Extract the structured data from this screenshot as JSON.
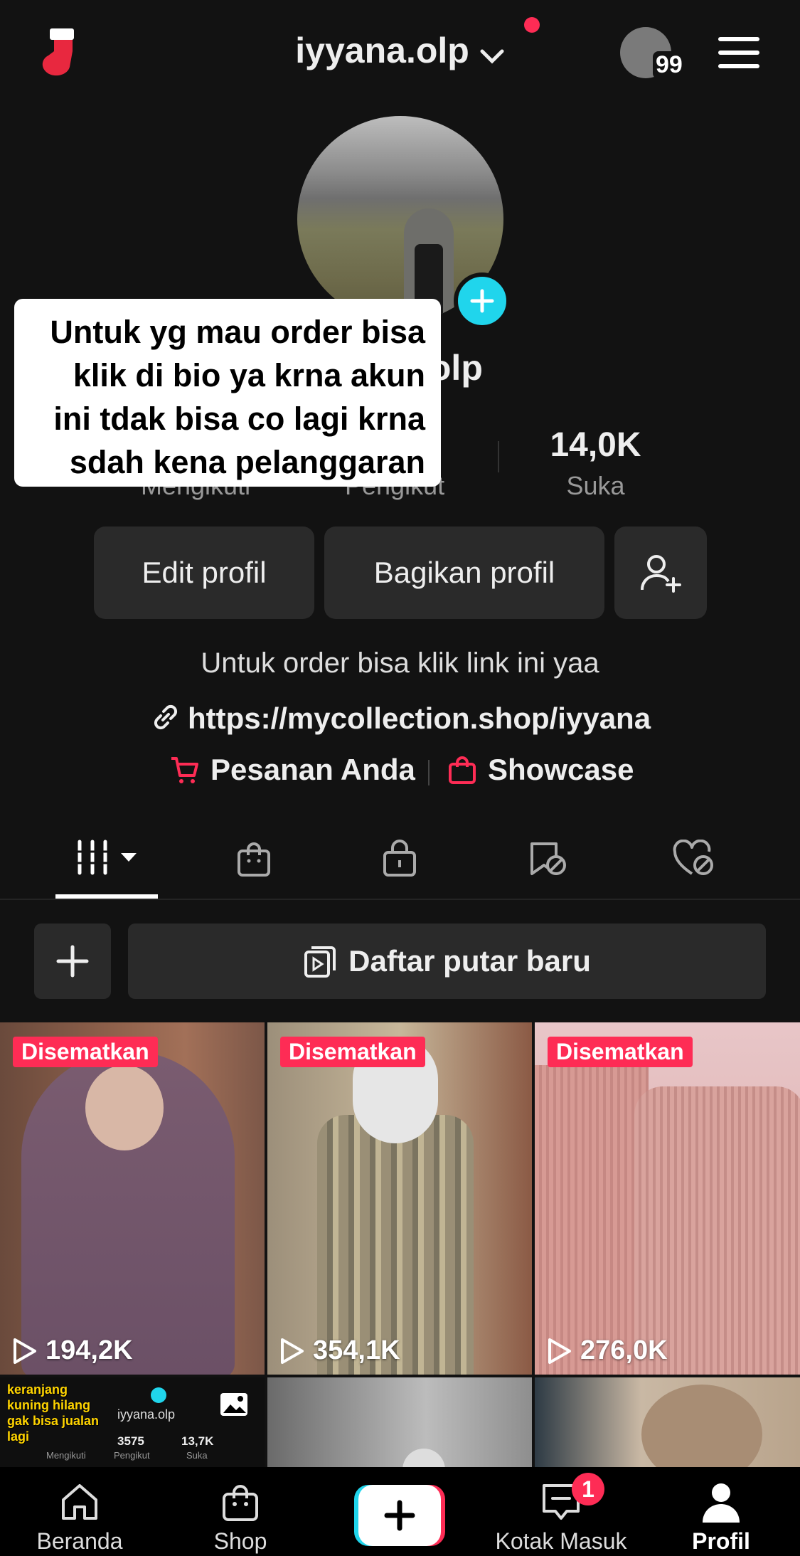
{
  "header": {
    "username": "iyyana.olp",
    "badge_count": "99"
  },
  "profile": {
    "name_partial": ".olp"
  },
  "overlay_caption": [
    "Untuk yg mau order bisa",
    "klik di bio ya krna akun",
    "ini tdak bisa co lagi krna",
    "sdah kena pelanggaran"
  ],
  "stats": {
    "following_label": "Mengikuti",
    "followers_label": "Pengikut",
    "likes_value": "14,0K",
    "likes_label": "Suka"
  },
  "actions": {
    "edit": "Edit profil",
    "share": "Bagikan profil"
  },
  "bio": {
    "text": "Untuk order bisa klik link ini yaa",
    "link": "https://mycollection.shop/iyyana"
  },
  "shop_links": {
    "orders": "Pesanan Anda",
    "showcase": "Showcase"
  },
  "playlist": {
    "label": "Daftar putar baru"
  },
  "videos": [
    {
      "pinned": "Disematkan",
      "views": "194,2K"
    },
    {
      "pinned": "Disematkan",
      "views": "354,1K"
    },
    {
      "pinned": "Disematkan",
      "views": "276,0K"
    }
  ],
  "row2_first": {
    "caption_lines": [
      "keranjang",
      "kuning hilang",
      "gak bisa jualan",
      "lagi"
    ],
    "mini_user": "iyyana.olp",
    "mini_stats": [
      {
        "value": "",
        "label": "Mengikuti"
      },
      {
        "value": "3575",
        "label": "Pengikut"
      },
      {
        "value": "13,7K",
        "label": "Suka"
      }
    ]
  },
  "bottom_nav": {
    "home": "Beranda",
    "shop": "Shop",
    "inbox": "Kotak Masuk",
    "inbox_badge": "1",
    "profile": "Profil"
  },
  "colors": {
    "accent": "#fe2c55",
    "background": "#121212",
    "plus_badge": "#20d5ec"
  }
}
